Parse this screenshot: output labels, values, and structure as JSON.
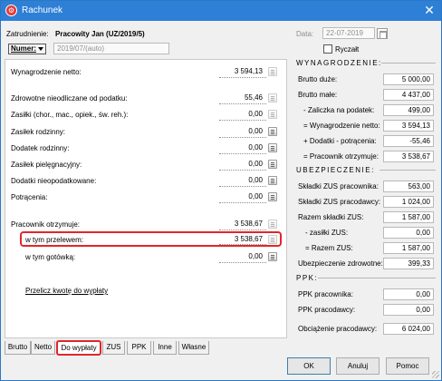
{
  "window": {
    "title": "Rachunek",
    "close": "✕",
    "app_icon": "⚙"
  },
  "header": {
    "employment_label": "Zatrudnienie:",
    "employment_value": "Pracowity Jan  (UZ/2019/5)",
    "number_label": "Numer:",
    "number_value": "2019/07/(auto)",
    "date_label": "Data:",
    "date_value": "22-07-2019",
    "ryczalt_label": "Ryczałt"
  },
  "left": {
    "rows": [
      {
        "label": "Wynagrodzenie netto:",
        "value": "3 594,13"
      },
      {
        "label": "Zdrowotne nieodliczane od podatku:",
        "value": "55,46"
      },
      {
        "label": "Zasiłki (chor., mac., opiek., św. reh.):",
        "value": "0,00"
      },
      {
        "label": "Zasiłek rodzinny:",
        "value": "0,00"
      },
      {
        "label": "Dodatek rodzinny:",
        "value": "0,00"
      },
      {
        "label": "Zasiłek pielęgnacyjny:",
        "value": "0,00"
      },
      {
        "label": "Dodatki nieopodatkowane:",
        "value": "0,00"
      },
      {
        "label": "Potrącenia:",
        "value": "0,00"
      },
      {
        "label": "Pracownik otrzymuje:",
        "value": "3 538,67"
      },
      {
        "label": "w tym przelewem:",
        "value": "3 538,67"
      },
      {
        "label": "w tym gotówką:",
        "value": "0,00"
      }
    ],
    "link": "Przelicz kwotę do wypłaty"
  },
  "right": {
    "wynagrodzenie_title": "WYNAGRODZENIE:",
    "wynagrodzenie": [
      {
        "label": "Brutto duże:",
        "value": "5 000,00"
      },
      {
        "label": "Brutto małe:",
        "value": "4 437,00"
      },
      {
        "label": "- Zaliczka na podatek:",
        "value": "499,00"
      },
      {
        "label": "= Wynagrodzenie netto:",
        "value": "3 594,13"
      },
      {
        "label": "+ Dodatki - potrącenia:",
        "value": "-55,46"
      },
      {
        "label": "= Pracownik otrzymuje:",
        "value": "3 538,67"
      }
    ],
    "ubezpieczenie_title": "UBEZPIECZENIE:",
    "ubezpieczenie": [
      {
        "label": "Składki ZUS pracownika:",
        "value": "563,00"
      },
      {
        "label": "Składki ZUS pracodawcy:",
        "value": "1 024,00"
      },
      {
        "label": "Razem składki ZUS:",
        "value": "1 587,00"
      },
      {
        "label": "- zasiłki ZUS:",
        "value": "0,00"
      },
      {
        "label": "= Razem ZUS:",
        "value": "1 587,00"
      },
      {
        "label": "Ubezpieczenie zdrowotne:",
        "value": "399,33"
      }
    ],
    "ppk_title": "PPK:",
    "ppk": [
      {
        "label": "PPK pracownika:",
        "value": "0,00"
      },
      {
        "label": "PPK pracodawcy:",
        "value": "0,00"
      }
    ],
    "obciazenie_label": "Obciążenie pracodawcy:",
    "obciazenie_value": "6 024,00"
  },
  "tabs": [
    "Brutto",
    "Netto",
    "Do wypłaty",
    "ZUS",
    "PPK",
    "Inne",
    "Własne"
  ],
  "buttons": {
    "ok": "OK",
    "cancel": "Anuluj",
    "help": "Pomoc"
  }
}
